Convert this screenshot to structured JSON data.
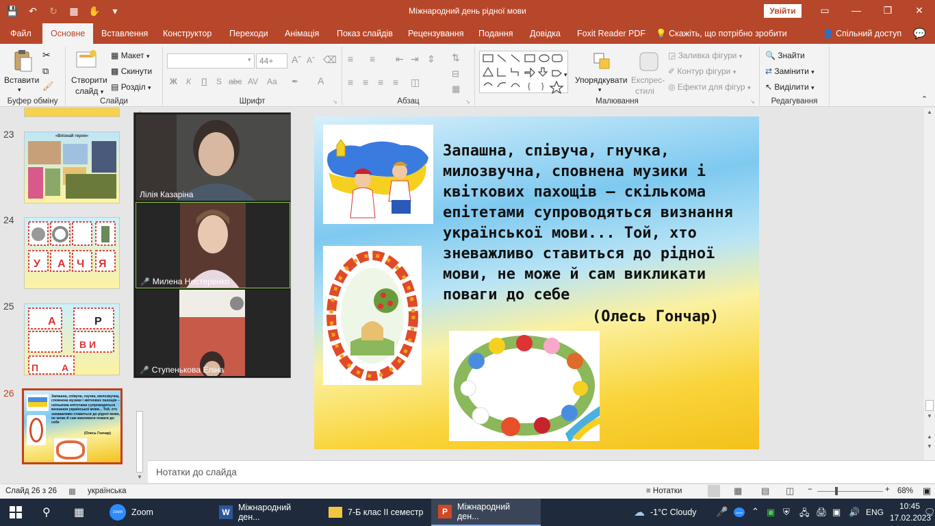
{
  "window": {
    "title": "Міжнародний день рідної мови",
    "signin": "Увійти"
  },
  "tabs": [
    "Файл",
    "Основне",
    "Вставлення",
    "Конструктор",
    "Переходи",
    "Анімація",
    "Показ слайдів",
    "Рецензування",
    "Подання",
    "Довідка",
    "Foxit Reader PDF",
    "Скажіть, що потрібно зробити",
    "Спільний доступ"
  ],
  "ribbon": {
    "clipboard": {
      "label": "Буфер обміну",
      "paste": "Вставити"
    },
    "slides": {
      "label": "Слайди",
      "new_slide": "Створити",
      "new_slide2": "слайд",
      "layout": "Макет",
      "reset": "Скинути",
      "section": "Розділ"
    },
    "font": {
      "label": "Шрифт",
      "font_name": "",
      "font_size": "44+",
      "bold": "Ж",
      "italic": "К",
      "underline": "П",
      "shadow": "S",
      "strike": "abc",
      "spacing": "AV",
      "case": "Aa"
    },
    "paragraph": {
      "label": "Абзац"
    },
    "drawing": {
      "label": "Малювання",
      "arrange": "Упорядкувати",
      "quick_styles": "Експрес-",
      "quick_styles2": "стилі",
      "fill": "Заливка фігури",
      "outline": "Контур фігури",
      "effects": "Ефекти для фігур"
    },
    "editing": {
      "label": "Редагування",
      "find": "Знайти",
      "replace": "Замінити",
      "select": "Виділити"
    }
  },
  "thumbnails": [
    {
      "num": "23",
      "caption": "«Впізнай героя»"
    },
    {
      "num": "24"
    },
    {
      "num": "25"
    },
    {
      "num": "26"
    }
  ],
  "zoom": {
    "participants": [
      "Лілія Казаріна",
      "Милена Нестеренко",
      "Ступенькова Еліна"
    ]
  },
  "slide": {
    "quote": "Запашна, співуча, гнучка, милозвучна, сповнена музики і квіткових пахощів – скількома епітетами супроводяться визнання української мови... Той, хто зневажливо ставиться до рідної мови, не може й сам викликати поваги до себе",
    "author": "(Олесь Гончар)"
  },
  "thumb26_text": "Запашна, співуча, гнучка, милозвучна, сповнена музики і квіткових пахощів – скількома епітетами супроводяться визнання української мови... Той, хто зневажливо ставиться до рідної мови, не може й сам викликати поваги до себе",
  "thumb26_author": "(Олесь Гончар)",
  "notes": {
    "placeholder": "Нотатки до слайда"
  },
  "status": {
    "slide_count": "Слайд 26 з 26",
    "language": "українська",
    "notes": "Нотатки",
    "zoom": "68%"
  },
  "taskbar": {
    "items": [
      "Zoom",
      "Міжнародний ден...",
      "7-Б клас ІІ семестр",
      "Міжнародний ден..."
    ],
    "zoom_badge": "zoom",
    "weather": "-1°C  Cloudy",
    "lang": "ENG",
    "time": "10:45",
    "date": "17.02.2023"
  }
}
